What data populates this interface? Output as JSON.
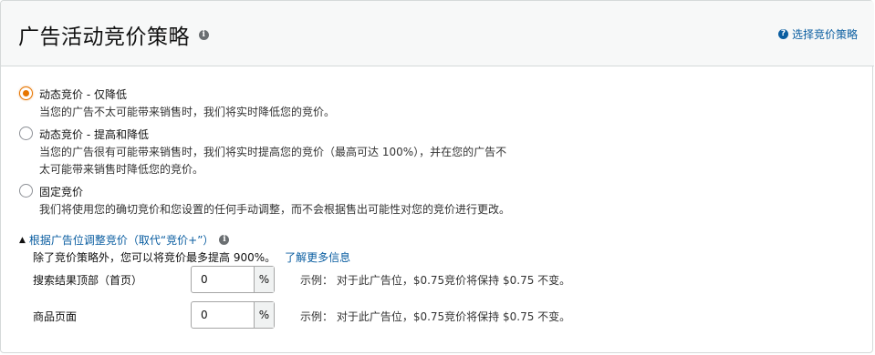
{
  "header": {
    "title": "广告活动竞价策略",
    "help_link": "选择竞价策略"
  },
  "options": [
    {
      "label": "动态竞价 - 仅降低",
      "desc": "当您的广告不太可能带来销售时，我们将实时降低您的竞价。",
      "checked": true
    },
    {
      "label": "动态竞价 - 提高和降低",
      "desc_line1": "当您的广告很有可能带来销售时，我们将实时提高您的竞价（最高可达 100%），并在您的广告不",
      "desc_line2": "太可能带来销售时降低您的竞价。",
      "checked": false
    },
    {
      "label": "固定竞价",
      "desc": "我们将使用您的确切竞价和您设置的任何手动调整，而不会根据售出可能性对您的竞价进行更改。",
      "checked": false
    }
  ],
  "adjust": {
    "toggle_label": "根据广告位调整竞价（取代“竞价+”）",
    "desc": "除了竞价策略外，您可以将竞价最多提高 900%。",
    "learn_more": "了解更多信息",
    "rows": [
      {
        "label": "搜索结果顶部（首页）",
        "value": "0",
        "suffix": "%",
        "example": "示例： 对于此广告位，$0.75竞价将保持 $0.75 不变。"
      },
      {
        "label": "商品页面",
        "value": "0",
        "suffix": "%",
        "example": "示例： 对于此广告位，$0.75竞价将保持 $0.75 不变。"
      }
    ]
  },
  "colors": {
    "accent": "#e77600",
    "link": "#0b5ea1",
    "border": "#d5d9d9"
  }
}
